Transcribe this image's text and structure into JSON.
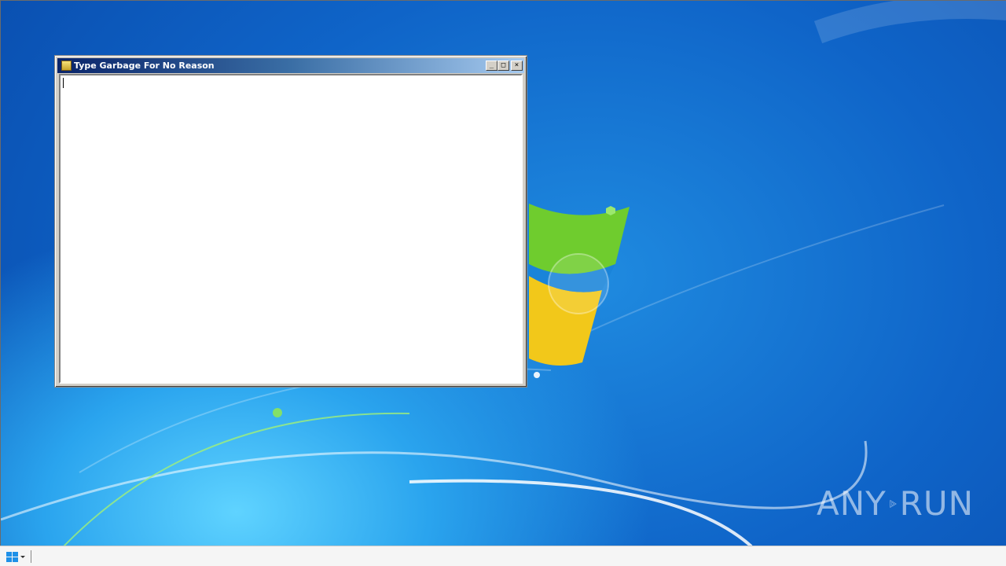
{
  "window": {
    "title": "Type Garbage For No Reason",
    "minimize_glyph": "_",
    "maximize_glyph": "□",
    "close_glyph": "×",
    "text_value": ""
  },
  "watermark": {
    "left_text": "ANY",
    "right_text": "RUN"
  },
  "taskbar": {
    "start_icon": "windows-logo-icon"
  },
  "colors": {
    "titlebar_start": "#0a246a",
    "titlebar_end": "#a6caf0",
    "desktop_blue": "#0f64c8"
  }
}
